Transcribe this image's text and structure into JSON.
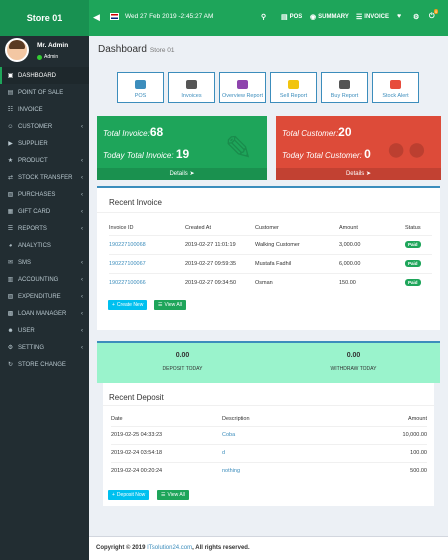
{
  "header": {
    "store": "Store 01",
    "datetime": "Wed 27 Feb 2019 -2:45:27 AM",
    "nav": [
      {
        "label": "",
        "icon": "search-icon"
      },
      {
        "label": "POS",
        "icon": "pos-icon"
      },
      {
        "label": "SUMMARY",
        "icon": "eye-icon"
      },
      {
        "label": "INVOICE",
        "icon": "list-icon"
      },
      {
        "label": "",
        "icon": "heart-icon"
      },
      {
        "label": "",
        "icon": "gear-icon"
      },
      {
        "label": "",
        "icon": "power-icon",
        "badge": "0"
      }
    ]
  },
  "user": {
    "name": "Mr. Admin",
    "role": "Admin"
  },
  "sidebar": {
    "items": [
      {
        "label": "DASHBOARD",
        "icon": "dashboard-icon",
        "active": true
      },
      {
        "label": "POINT OF SALE",
        "icon": "pos-icon"
      },
      {
        "label": "INVOICE",
        "icon": "invoice-icon"
      },
      {
        "label": "CUSTOMER",
        "icon": "users-icon",
        "chevron": true
      },
      {
        "label": "SUPPLIER",
        "icon": "truck-icon"
      },
      {
        "label": "PRODUCT",
        "icon": "star-icon",
        "chevron": true
      },
      {
        "label": "STOCK TRANSFER",
        "icon": "transfer-icon",
        "chevron": true
      },
      {
        "label": "PURCHASES",
        "icon": "cart-icon",
        "chevron": true
      },
      {
        "label": "GIFT CARD",
        "icon": "gift-icon",
        "chevron": true
      },
      {
        "label": "REPORTS",
        "icon": "bar-chart-icon",
        "chevron": true
      },
      {
        "label": "ANALYTICS",
        "icon": "analytics-icon"
      },
      {
        "label": "SMS",
        "icon": "sms-icon",
        "chevron": true
      },
      {
        "label": "ACCOUNTING",
        "icon": "accounting-icon",
        "chevron": true
      },
      {
        "label": "EXPENDITURE",
        "icon": "money-icon",
        "chevron": true
      },
      {
        "label": "LOAN MANAGER",
        "icon": "loan-icon",
        "chevron": true
      },
      {
        "label": "USER",
        "icon": "user-icon",
        "chevron": true
      },
      {
        "label": "SETTING",
        "icon": "gear-icon",
        "chevron": true
      },
      {
        "label": "STORE CHANGE",
        "icon": "exchange-icon"
      }
    ]
  },
  "page": {
    "title": "Dashboard",
    "subtitle": "Store 01"
  },
  "quick": [
    {
      "label": "POS",
      "icon": "pos-icon",
      "color": "#3c8dbc"
    },
    {
      "label": "Invoices",
      "icon": "invoice-icon",
      "color": "#555555"
    },
    {
      "label": "Overview Report",
      "icon": "flag-icon",
      "color": "#8e44ad"
    },
    {
      "label": "Sell Report",
      "icon": "sell-report-icon",
      "color": "#f1c40f"
    },
    {
      "label": "Buy Report",
      "icon": "mobile-icon",
      "color": "#555555"
    },
    {
      "label": "Stock Alert",
      "icon": "megaphone-icon",
      "color": "#e74c3c"
    }
  ],
  "stats": {
    "invoice": {
      "total_label": "Total Invoice:",
      "total": "68",
      "today_label": "Today Total Invoice:",
      "today": "19",
      "details": "Details",
      "color": "#1ea55a"
    },
    "customer": {
      "total_label": "Total Customer:",
      "total": "20",
      "today_label": "Today Total Customer:",
      "today": "0",
      "details": "Details",
      "color": "#dd4b39"
    }
  },
  "recent_invoice": {
    "title": "Recent Invoice",
    "columns": [
      "Invoice ID",
      "Created At",
      "Customer",
      "Amount",
      "Status"
    ],
    "rows": [
      {
        "id": "190227100068",
        "created": "2019-02-27 11:01:19",
        "customer": "Walking Customer",
        "amount": "3,000.00",
        "status": "Paid"
      },
      {
        "id": "190227100067",
        "created": "2019-02-27 09:59:35",
        "customer": "Mustafa Fadhil",
        "amount": "6,000.00",
        "status": "Paid"
      },
      {
        "id": "190227100066",
        "created": "2019-02-27 09:34:50",
        "customer": "Osman",
        "amount": "150.00",
        "status": "Paid"
      }
    ],
    "create_label": "Create New",
    "view_label": "View All"
  },
  "deposit_summary": {
    "today_value": "0.00",
    "today_label": "DEPOSIT TODAY",
    "withdraw_value": "0.00",
    "withdraw_label": "WITHDRAW TODAY"
  },
  "recent_deposit": {
    "title": "Recent Deposit",
    "columns": [
      "Date",
      "Description",
      "Amount"
    ],
    "rows": [
      {
        "date": "2019-02-25 04:33:23",
        "desc": "Coba",
        "amount": "10,000.00"
      },
      {
        "date": "2019-02-24 03:54:18",
        "desc": "d",
        "amount": "100.00"
      },
      {
        "date": "2019-02-24 00:20:24",
        "desc": "nothing",
        "amount": "500.00"
      }
    ],
    "deposit_label": "Deposit Now",
    "view_label": "View All"
  },
  "footer": {
    "prefix": "Copyright © 2019",
    "link": "ITsolution24.com",
    "suffix": ", All rights reserved."
  }
}
